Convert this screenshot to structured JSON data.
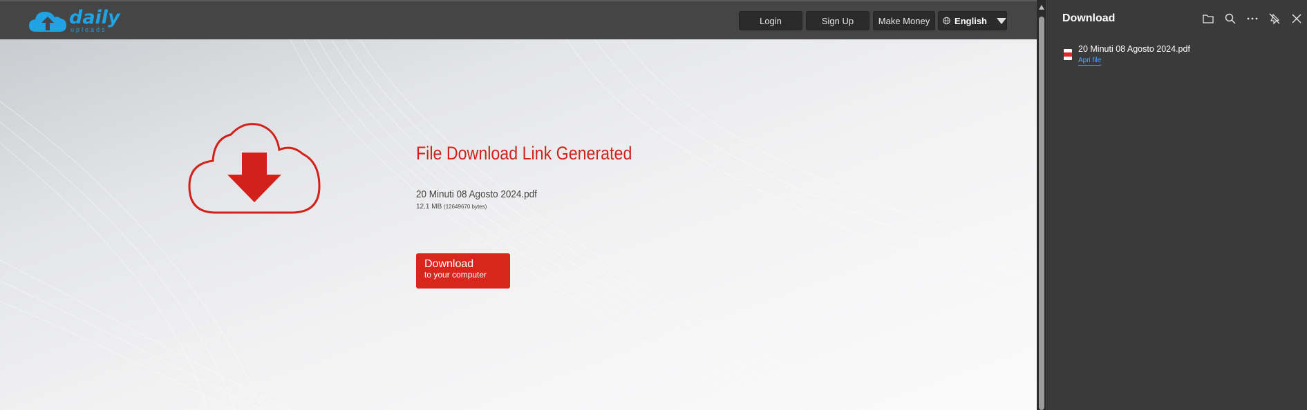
{
  "header": {
    "logo_text": "daily",
    "logo_subtext": "uploads",
    "nav": [
      {
        "label": "Login"
      },
      {
        "label": "Sign Up"
      },
      {
        "label": "Make Money"
      }
    ],
    "language": "English"
  },
  "main": {
    "title": "File Download Link Generated",
    "file_name": "20 Minuti 08 Agosto 2024.pdf",
    "file_size": "12.1 MB",
    "file_bytes": "(12649670 bytes)",
    "download_button": {
      "line1": "Download",
      "line2": "to your computer"
    }
  },
  "download_panel": {
    "title": "Download",
    "toolbar_icons": [
      "folder-icon",
      "search-icon",
      "more-icon",
      "unpin-icon",
      "close-icon"
    ],
    "items": [
      {
        "name": "20 Minuti 08 Agosto 2024.pdf",
        "action": "Apri file",
        "icon": "pdf-file-icon"
      }
    ]
  },
  "colors": {
    "accent_red": "#d9261c",
    "logo_blue": "#1fa3e4",
    "link_blue": "#4ea3ff",
    "topbar": "#454545",
    "panel_bg": "#3a3a3a"
  }
}
